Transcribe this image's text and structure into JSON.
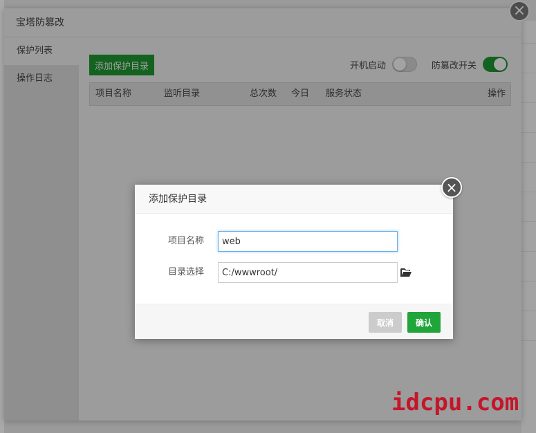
{
  "main_window": {
    "title": "宝塔防篡改",
    "close_icon": "close-icon"
  },
  "side_menu": {
    "items": [
      {
        "label": "保护列表",
        "active": true
      },
      {
        "label": "操作日志",
        "active": false
      }
    ]
  },
  "content": {
    "add_button_label": "添加保护目录",
    "boot_toggle": {
      "label": "开机启动",
      "on": false
    },
    "tamper_toggle": {
      "label": "防篡改开关",
      "on": true
    },
    "table_headers": [
      "项目名称",
      "监听目录",
      "总次数",
      "今日",
      "服务状态",
      "操作"
    ]
  },
  "dialog": {
    "title": "添加保护目录",
    "close_icon": "close-icon",
    "fields": {
      "name_label": "项目名称",
      "name_value": "web",
      "dir_label": "目录选择",
      "dir_value": "C:/wwwroot/",
      "folder_icon": "folder-open-icon"
    },
    "cancel_label": "取消",
    "ok_label": "确认"
  },
  "watermark": "idcpu.com",
  "colors": {
    "accent_green": "#20a53a",
    "cancel_gray": "#cccccc",
    "focus_blue": "#66afe9",
    "watermark_red": "#c4162a"
  }
}
